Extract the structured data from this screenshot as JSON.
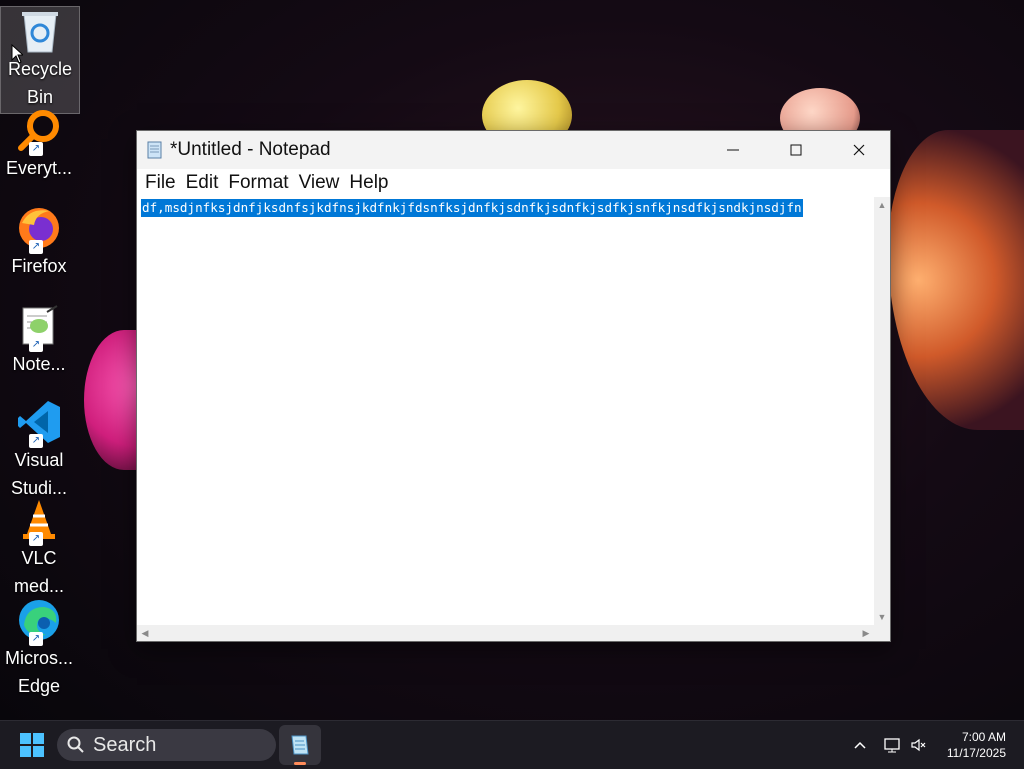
{
  "desktop": {
    "icons": [
      {
        "label": "Recycle Bin"
      },
      {
        "label": "Everyt..."
      },
      {
        "label": "Firefox"
      },
      {
        "label": "Note..."
      },
      {
        "label": "Visual Studi..."
      },
      {
        "label": "VLC med..."
      },
      {
        "label": "Micros... Edge"
      }
    ]
  },
  "window": {
    "title": "*Untitled - Notepad",
    "menu": [
      "File",
      "Edit",
      "Format",
      "View",
      "Help"
    ],
    "content": "df,msdjnfksjdnfjksdnfsjkdfnsjkdfnkjfdsnfksjdnfkjsdnfkjsdnfkjsdfkjsnfkjnsdfkjsndkjnsdjfn",
    "selection_color": "#0078d7"
  },
  "taskbar": {
    "search_placeholder": "Search",
    "time": "7:00 AM",
    "date": "11/17/2025",
    "accent": "#4cc2ff"
  }
}
